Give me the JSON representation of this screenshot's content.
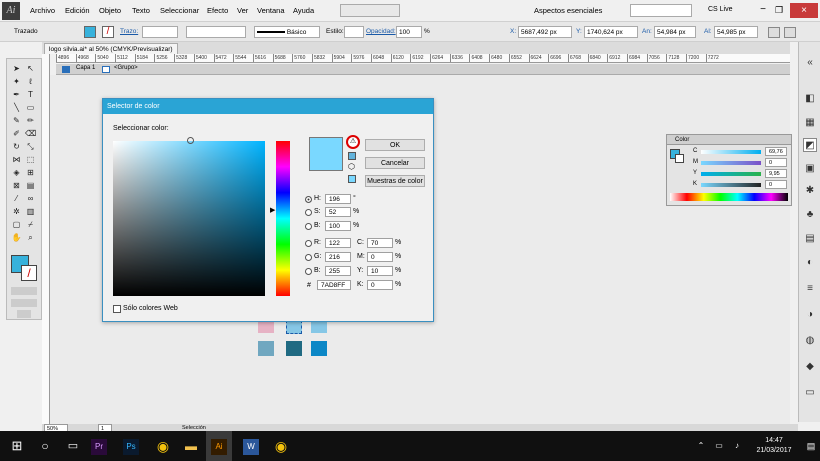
{
  "app": {
    "logo": "Ai"
  },
  "menu": [
    "Archivo",
    "Edición",
    "Objeto",
    "Texto",
    "Seleccionar",
    "Efecto",
    "Ver",
    "Ventana",
    "Ayuda"
  ],
  "topright": {
    "workspace": "Aspectos esenciales",
    "search_placeholder": "",
    "cslive": "CS Live"
  },
  "control": {
    "mode": "Trazado",
    "stroke_label": "Trazo:",
    "stroke_style": "Básico",
    "style_label": "Estilo:",
    "opacity_label": "Opacidad:",
    "opacity": "100",
    "opacity_unit": "%",
    "x_label": "X:",
    "x": "5687,492 px",
    "y_label": "Y:",
    "y": "1740,624 px",
    "w_label": "An:",
    "w": "54,984 px",
    "h_label": "Al:",
    "h": "54,985 px"
  },
  "document": {
    "tab": "logo silvia.ai* al 50% (CMYK/Previsualizar)"
  },
  "ruler": [
    "4896",
    "4968",
    "5040",
    "5112",
    "5184",
    "5256",
    "5328",
    "5400",
    "5472",
    "5544",
    "5616",
    "5688",
    "5760",
    "5832",
    "5904",
    "5976",
    "6048",
    "6120",
    "6192",
    "6264",
    "6336",
    "6408",
    "6480",
    "6552",
    "6624",
    "6696",
    "6768",
    "6840",
    "6912",
    "6984",
    "7056",
    "7128",
    "7200",
    "7272"
  ],
  "layers": {
    "layer": "Capa 1",
    "group": "<Grupo>"
  },
  "dialog": {
    "title": "Selector de color",
    "select_label": "Seleccionar color:",
    "ok": "OK",
    "cancel": "Cancelar",
    "swatches": "Muestras de color",
    "h_label": "H:",
    "h": "196",
    "h_unit": "°",
    "s_label": "S:",
    "s": "52",
    "s_unit": "%",
    "b_label": "B:",
    "b": "100",
    "b_unit": "%",
    "r_label": "R:",
    "r": "122",
    "g_label": "G:",
    "g": "216",
    "bb_label": "B:",
    "bb": "255",
    "c_label": "C:",
    "c": "70",
    "m_label": "M:",
    "m": "0",
    "y_label": "Y:",
    "y": "10",
    "k_label": "K:",
    "k": "0",
    "pct": "%",
    "hash": "#",
    "hex": "7AD8FF",
    "websafe": "Sólo colores Web",
    "new_color": "#7ad8ff"
  },
  "colorpanel": {
    "title": "Color",
    "c": "69,76",
    "m": "0",
    "y": "9,95",
    "k": "0",
    "c_label": "C",
    "m_label": "M",
    "y_label": "Y",
    "k_label": "K",
    "pct": "%"
  },
  "status": {
    "zoom": "50%",
    "page": "1",
    "tool": "Selección"
  },
  "taskbar": {
    "time": "14:47",
    "date": "21/03/2017"
  },
  "swatch_colors": [
    "#e6b2c4",
    "#86c7e6",
    "#86c7e6",
    "#70a7c0",
    "#206a82",
    "#0c87c6"
  ]
}
